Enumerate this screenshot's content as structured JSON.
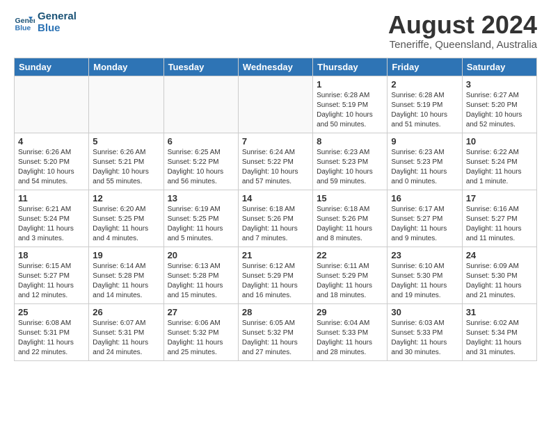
{
  "logo": {
    "line1": "General",
    "line2": "Blue"
  },
  "title": "August 2024",
  "subtitle": "Teneriffe, Queensland, Australia",
  "days_of_week": [
    "Sunday",
    "Monday",
    "Tuesday",
    "Wednesday",
    "Thursday",
    "Friday",
    "Saturday"
  ],
  "weeks": [
    [
      {
        "day": "",
        "sunrise": "",
        "sunset": "",
        "daylight": ""
      },
      {
        "day": "",
        "sunrise": "",
        "sunset": "",
        "daylight": ""
      },
      {
        "day": "",
        "sunrise": "",
        "sunset": "",
        "daylight": ""
      },
      {
        "day": "",
        "sunrise": "",
        "sunset": "",
        "daylight": ""
      },
      {
        "day": "1",
        "sunrise": "Sunrise: 6:28 AM",
        "sunset": "Sunset: 5:19 PM",
        "daylight": "Daylight: 10 hours and 50 minutes."
      },
      {
        "day": "2",
        "sunrise": "Sunrise: 6:28 AM",
        "sunset": "Sunset: 5:19 PM",
        "daylight": "Daylight: 10 hours and 51 minutes."
      },
      {
        "day": "3",
        "sunrise": "Sunrise: 6:27 AM",
        "sunset": "Sunset: 5:20 PM",
        "daylight": "Daylight: 10 hours and 52 minutes."
      }
    ],
    [
      {
        "day": "4",
        "sunrise": "Sunrise: 6:26 AM",
        "sunset": "Sunset: 5:20 PM",
        "daylight": "Daylight: 10 hours and 54 minutes."
      },
      {
        "day": "5",
        "sunrise": "Sunrise: 6:26 AM",
        "sunset": "Sunset: 5:21 PM",
        "daylight": "Daylight: 10 hours and 55 minutes."
      },
      {
        "day": "6",
        "sunrise": "Sunrise: 6:25 AM",
        "sunset": "Sunset: 5:22 PM",
        "daylight": "Daylight: 10 hours and 56 minutes."
      },
      {
        "day": "7",
        "sunrise": "Sunrise: 6:24 AM",
        "sunset": "Sunset: 5:22 PM",
        "daylight": "Daylight: 10 hours and 57 minutes."
      },
      {
        "day": "8",
        "sunrise": "Sunrise: 6:23 AM",
        "sunset": "Sunset: 5:23 PM",
        "daylight": "Daylight: 10 hours and 59 minutes."
      },
      {
        "day": "9",
        "sunrise": "Sunrise: 6:23 AM",
        "sunset": "Sunset: 5:23 PM",
        "daylight": "Daylight: 11 hours and 0 minutes."
      },
      {
        "day": "10",
        "sunrise": "Sunrise: 6:22 AM",
        "sunset": "Sunset: 5:24 PM",
        "daylight": "Daylight: 11 hours and 1 minute."
      }
    ],
    [
      {
        "day": "11",
        "sunrise": "Sunrise: 6:21 AM",
        "sunset": "Sunset: 5:24 PM",
        "daylight": "Daylight: 11 hours and 3 minutes."
      },
      {
        "day": "12",
        "sunrise": "Sunrise: 6:20 AM",
        "sunset": "Sunset: 5:25 PM",
        "daylight": "Daylight: 11 hours and 4 minutes."
      },
      {
        "day": "13",
        "sunrise": "Sunrise: 6:19 AM",
        "sunset": "Sunset: 5:25 PM",
        "daylight": "Daylight: 11 hours and 5 minutes."
      },
      {
        "day": "14",
        "sunrise": "Sunrise: 6:18 AM",
        "sunset": "Sunset: 5:26 PM",
        "daylight": "Daylight: 11 hours and 7 minutes."
      },
      {
        "day": "15",
        "sunrise": "Sunrise: 6:18 AM",
        "sunset": "Sunset: 5:26 PM",
        "daylight": "Daylight: 11 hours and 8 minutes."
      },
      {
        "day": "16",
        "sunrise": "Sunrise: 6:17 AM",
        "sunset": "Sunset: 5:27 PM",
        "daylight": "Daylight: 11 hours and 9 minutes."
      },
      {
        "day": "17",
        "sunrise": "Sunrise: 6:16 AM",
        "sunset": "Sunset: 5:27 PM",
        "daylight": "Daylight: 11 hours and 11 minutes."
      }
    ],
    [
      {
        "day": "18",
        "sunrise": "Sunrise: 6:15 AM",
        "sunset": "Sunset: 5:27 PM",
        "daylight": "Daylight: 11 hours and 12 minutes."
      },
      {
        "day": "19",
        "sunrise": "Sunrise: 6:14 AM",
        "sunset": "Sunset: 5:28 PM",
        "daylight": "Daylight: 11 hours and 14 minutes."
      },
      {
        "day": "20",
        "sunrise": "Sunrise: 6:13 AM",
        "sunset": "Sunset: 5:28 PM",
        "daylight": "Daylight: 11 hours and 15 minutes."
      },
      {
        "day": "21",
        "sunrise": "Sunrise: 6:12 AM",
        "sunset": "Sunset: 5:29 PM",
        "daylight": "Daylight: 11 hours and 16 minutes."
      },
      {
        "day": "22",
        "sunrise": "Sunrise: 6:11 AM",
        "sunset": "Sunset: 5:29 PM",
        "daylight": "Daylight: 11 hours and 18 minutes."
      },
      {
        "day": "23",
        "sunrise": "Sunrise: 6:10 AM",
        "sunset": "Sunset: 5:30 PM",
        "daylight": "Daylight: 11 hours and 19 minutes."
      },
      {
        "day": "24",
        "sunrise": "Sunrise: 6:09 AM",
        "sunset": "Sunset: 5:30 PM",
        "daylight": "Daylight: 11 hours and 21 minutes."
      }
    ],
    [
      {
        "day": "25",
        "sunrise": "Sunrise: 6:08 AM",
        "sunset": "Sunset: 5:31 PM",
        "daylight": "Daylight: 11 hours and 22 minutes."
      },
      {
        "day": "26",
        "sunrise": "Sunrise: 6:07 AM",
        "sunset": "Sunset: 5:31 PM",
        "daylight": "Daylight: 11 hours and 24 minutes."
      },
      {
        "day": "27",
        "sunrise": "Sunrise: 6:06 AM",
        "sunset": "Sunset: 5:32 PM",
        "daylight": "Daylight: 11 hours and 25 minutes."
      },
      {
        "day": "28",
        "sunrise": "Sunrise: 6:05 AM",
        "sunset": "Sunset: 5:32 PM",
        "daylight": "Daylight: 11 hours and 27 minutes."
      },
      {
        "day": "29",
        "sunrise": "Sunrise: 6:04 AM",
        "sunset": "Sunset: 5:33 PM",
        "daylight": "Daylight: 11 hours and 28 minutes."
      },
      {
        "day": "30",
        "sunrise": "Sunrise: 6:03 AM",
        "sunset": "Sunset: 5:33 PM",
        "daylight": "Daylight: 11 hours and 30 minutes."
      },
      {
        "day": "31",
        "sunrise": "Sunrise: 6:02 AM",
        "sunset": "Sunset: 5:34 PM",
        "daylight": "Daylight: 11 hours and 31 minutes."
      }
    ]
  ]
}
